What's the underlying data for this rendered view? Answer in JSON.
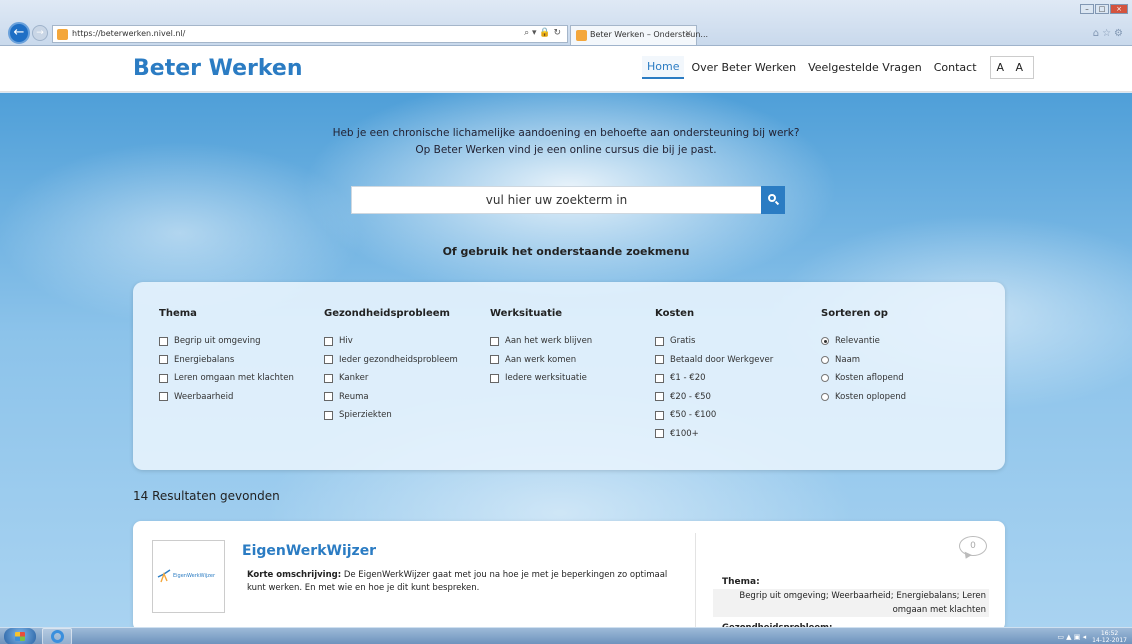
{
  "browser": {
    "url": "https://beterwerken.nivel.nl/",
    "tab_title": "Beter Werken – Ondersteun...",
    "tab_close": "×",
    "addr_tools": "⌕ ▾ 🔒 ↻"
  },
  "header": {
    "logo": "Beter Werken",
    "menu": [
      "Home",
      "Over Beter Werken",
      "Veelgestelde Vragen",
      "Contact"
    ],
    "active_menu": "Home",
    "font_toggle": "A A"
  },
  "hero": {
    "intro_line1": "Heb je een chronische lichamelijke aandoening en behoefte aan ondersteuning bij werk?",
    "intro_line2": "Op Beter Werken vind je een online cursus die bij je past.",
    "search_placeholder": "vul hier uw zoekterm in",
    "or_label": "Of gebruik het onderstaande zoekmenu"
  },
  "filters": {
    "thema": {
      "title": "Thema",
      "options": [
        "Begrip uit omgeving",
        "Energiebalans",
        "Leren omgaan met klachten",
        "Weerbaarheid"
      ]
    },
    "gezondheid": {
      "title": "Gezondheidsprobleem",
      "options": [
        "Hiv",
        "Ieder gezondheidsprobleem",
        "Kanker",
        "Reuma",
        "Spierziekten"
      ]
    },
    "werksituatie": {
      "title": "Werksituatie",
      "options": [
        "Aan het werk blijven",
        "Aan werk komen",
        "Iedere werksituatie"
      ]
    },
    "kosten": {
      "title": "Kosten",
      "options": [
        "Gratis",
        "Betaald door Werkgever",
        "€1 - €20",
        "€20 - €50",
        "€50 - €100",
        "€100+"
      ]
    },
    "sorteren": {
      "title": "Sorteren op",
      "options": [
        "Relevantie",
        "Naam",
        "Kosten aflopend",
        "Kosten oplopend"
      ],
      "selected": "Relevantie"
    }
  },
  "results": {
    "count_text": "14 Resultaten gevonden",
    "items": [
      {
        "title": "EigenWerkWijzer",
        "logo_text": "EigenWerkWijzer",
        "desc_label": "Korte omschrijving:",
        "desc": " De EigenWerkWijzer gaat met jou na hoe je met je beperkingen zo optimaal kunt werken. En met wie en hoe je dit kunt bespreken.",
        "comments": "0",
        "theme_label": "Thema:",
        "theme_value": "Begrip uit omgeving; Weerbaarheid; Energiebalans; Leren omgaan met klachten",
        "cutoff_label": "Gezondheidsprobleem:"
      }
    ]
  },
  "taskbar": {
    "time": "16:52",
    "date": "14-12-2017"
  },
  "colors": {
    "brand": "#2b7cc3"
  }
}
